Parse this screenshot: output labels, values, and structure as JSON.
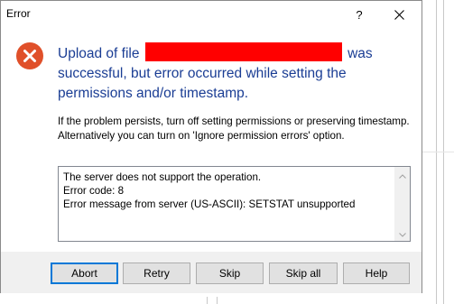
{
  "window": {
    "title": "Error",
    "help_glyph": "?"
  },
  "message": {
    "headline_before": "Upload of file",
    "headline_after": "was successful, but error occurred while setting the permissions and/or timestamp.",
    "description": "If the problem persists, turn off setting permissions or preserving timestamp. Alternatively you can turn on 'Ignore permission errors' option."
  },
  "details": {
    "lines": [
      "The server does not support the operation.",
      "Error code: 8",
      "Error message from server (US-ASCII): SETSTAT unsupported"
    ]
  },
  "buttons": {
    "abort": "Abort",
    "retry": "Retry",
    "skip": "Skip",
    "skip_all": "Skip all",
    "help": "Help"
  },
  "icons": {
    "error": "error-x-icon",
    "close": "close-icon",
    "scroll_up": "chevron-up-icon",
    "scroll_down": "chevron-down-icon"
  },
  "colors": {
    "headline": "#1a3d94",
    "error_icon": "#e0502a",
    "redaction": "#ff0000",
    "focus_border": "#0078d7"
  }
}
